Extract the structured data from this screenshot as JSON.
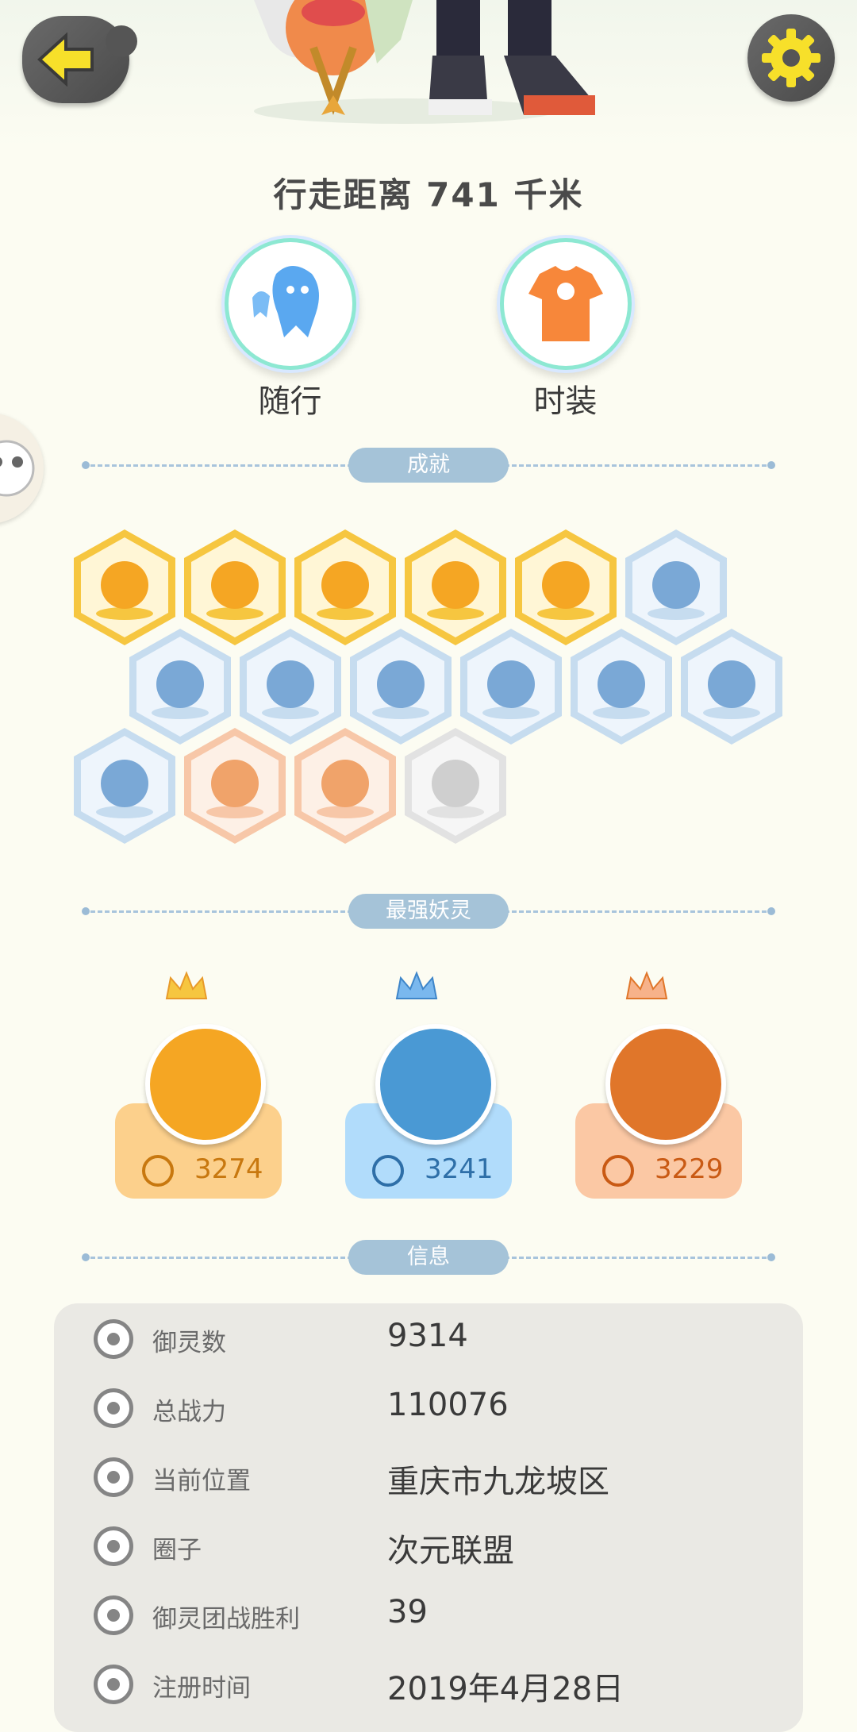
{
  "header": {
    "back_icon": "arrow-left-icon",
    "settings_icon": "gear-icon",
    "distance_text": "行走距离 741 千米"
  },
  "quick_buttons": [
    {
      "label": "随行",
      "icon": "ghost-companion-icon"
    },
    {
      "label": "时装",
      "icon": "tshirt-icon"
    }
  ],
  "sections": {
    "achievements": "成就",
    "strongest": "最强妖灵",
    "info": "信息"
  },
  "achievements": [
    {
      "icon": "sun-badge-icon",
      "tier": "gold"
    },
    {
      "icon": "cat-moon-badge-icon",
      "tier": "gold"
    },
    {
      "icon": "orb-badge-icon",
      "tier": "gold"
    },
    {
      "icon": "yin-yang-ball-badge-icon",
      "tier": "gold"
    },
    {
      "icon": "fox-spirit-badge-icon",
      "tier": "gold"
    },
    {
      "icon": "sneaker-badge-icon",
      "tier": "blue"
    },
    {
      "icon": "moon-badge-icon",
      "tier": "blue"
    },
    {
      "icon": "crystal-badge-icon",
      "tier": "blue"
    },
    {
      "icon": "spirit-figure-badge-icon",
      "tier": "blue"
    },
    {
      "icon": "yin-yang-flag-badge-icon",
      "tier": "blue"
    },
    {
      "icon": "koi-badge-icon",
      "tier": "blue"
    },
    {
      "icon": "shield-badge-icon",
      "tier": "blue"
    },
    {
      "icon": "book-fox-badge-icon",
      "tier": "blue"
    },
    {
      "icon": "demon-badge-icon",
      "tier": "orange"
    },
    {
      "icon": "twin-spirits-badge-icon",
      "tier": "orange"
    },
    {
      "icon": "cart-cat-badge-icon",
      "tier": "gray"
    }
  ],
  "strongest_spirits": [
    {
      "power": "3274",
      "tier": "gold",
      "icon": "crown-icon"
    },
    {
      "power": "3241",
      "tier": "blue",
      "icon": "crown-icon"
    },
    {
      "power": "3229",
      "tier": "orange",
      "icon": "crown-icon"
    }
  ],
  "info": {
    "rows": [
      {
        "label": "御灵数",
        "value": "9314",
        "icon": "spirit-count-icon"
      },
      {
        "label": "总战力",
        "value": "110076",
        "icon": "power-icon"
      },
      {
        "label": "当前位置",
        "value": "重庆市九龙坡区",
        "icon": "location-pin-icon"
      },
      {
        "label": "圈子",
        "value": "次元联盟",
        "icon": "circle-target-icon"
      },
      {
        "label": "御灵团战胜利",
        "value": "39",
        "icon": "trophy-figure-icon"
      },
      {
        "label": "注册时间",
        "value": "2019年4月28日",
        "icon": "clock-icon"
      }
    ]
  },
  "colors": {
    "background": "#fcfcf2",
    "gold": "#f6c640",
    "blue": "#a8d2f0",
    "orange": "#f7b28a",
    "gray": "#d8d8d8",
    "section_pill": "#a5c3d8",
    "info_panel": "#eae9e4"
  }
}
